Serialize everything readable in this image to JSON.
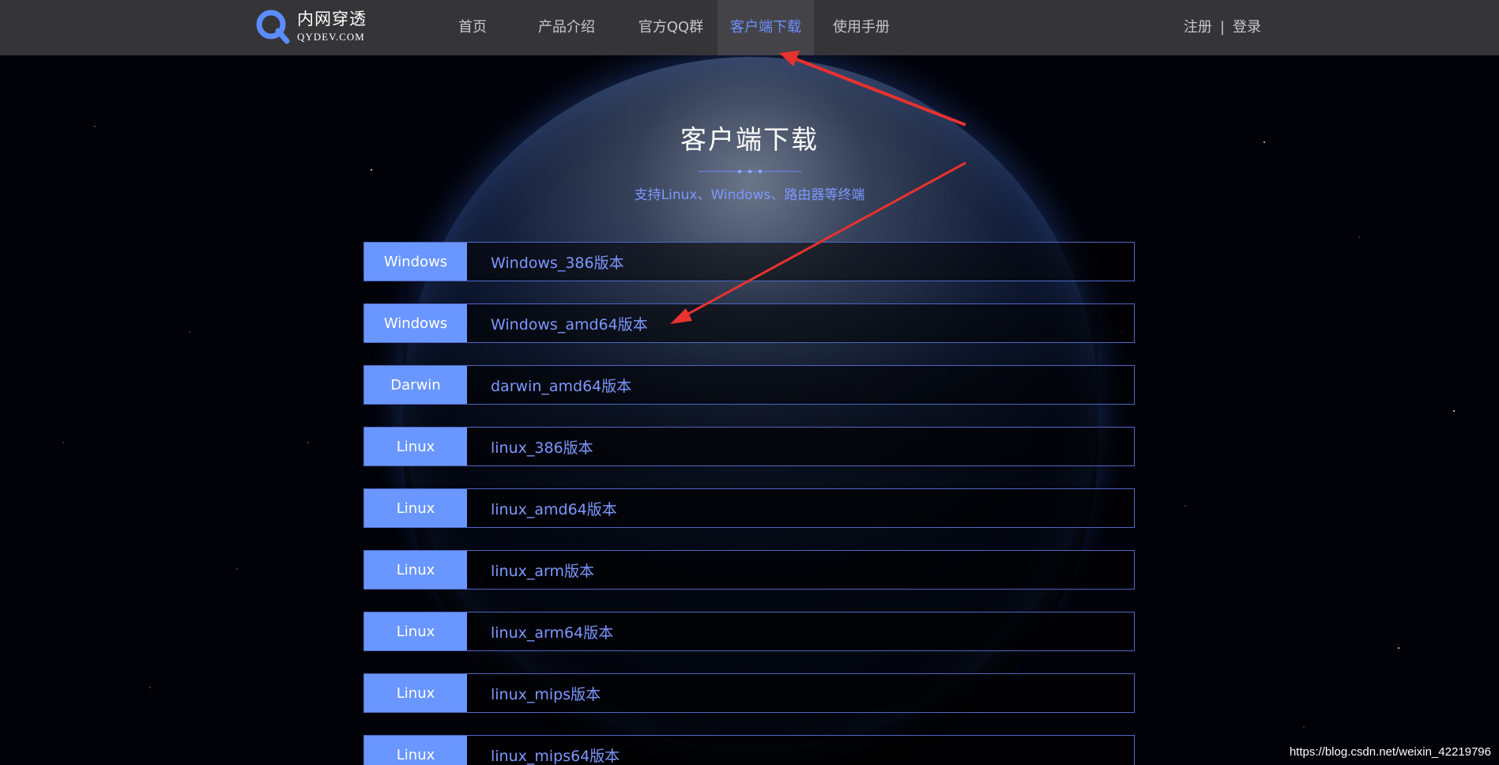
{
  "header": {
    "logo_title": "内网穿透",
    "logo_subtitle": "QYDEV.COM",
    "nav": [
      {
        "label": "首页"
      },
      {
        "label": "产品介绍"
      },
      {
        "label": "官方QQ群"
      },
      {
        "label": "客户端下载",
        "active": true
      },
      {
        "label": "使用手册"
      }
    ],
    "auth": {
      "register": "注册",
      "separator": "|",
      "login": "登录"
    }
  },
  "hero": {
    "title": "客户端下载",
    "subtitle": "支持Linux、Windows、路由器等终端"
  },
  "downloads": [
    {
      "os": "Windows",
      "label": "Windows_386版本"
    },
    {
      "os": "Windows",
      "label": "Windows_amd64版本"
    },
    {
      "os": "Darwin",
      "label": "darwin_amd64版本"
    },
    {
      "os": "Linux",
      "label": "linux_386版本"
    },
    {
      "os": "Linux",
      "label": "linux_amd64版本"
    },
    {
      "os": "Linux",
      "label": "linux_arm版本"
    },
    {
      "os": "Linux",
      "label": "linux_arm64版本"
    },
    {
      "os": "Linux",
      "label": "linux_mips版本"
    },
    {
      "os": "Linux",
      "label": "linux_mips64版本"
    }
  ],
  "watermark": "https://blog.csdn.net/weixin_42219796",
  "colors": {
    "header_bg": "#353437",
    "accent": "#6a97ff",
    "link": "#7d98ff",
    "arrow": "#e8322f"
  },
  "icons": {
    "logo": "q-logo-icon"
  }
}
